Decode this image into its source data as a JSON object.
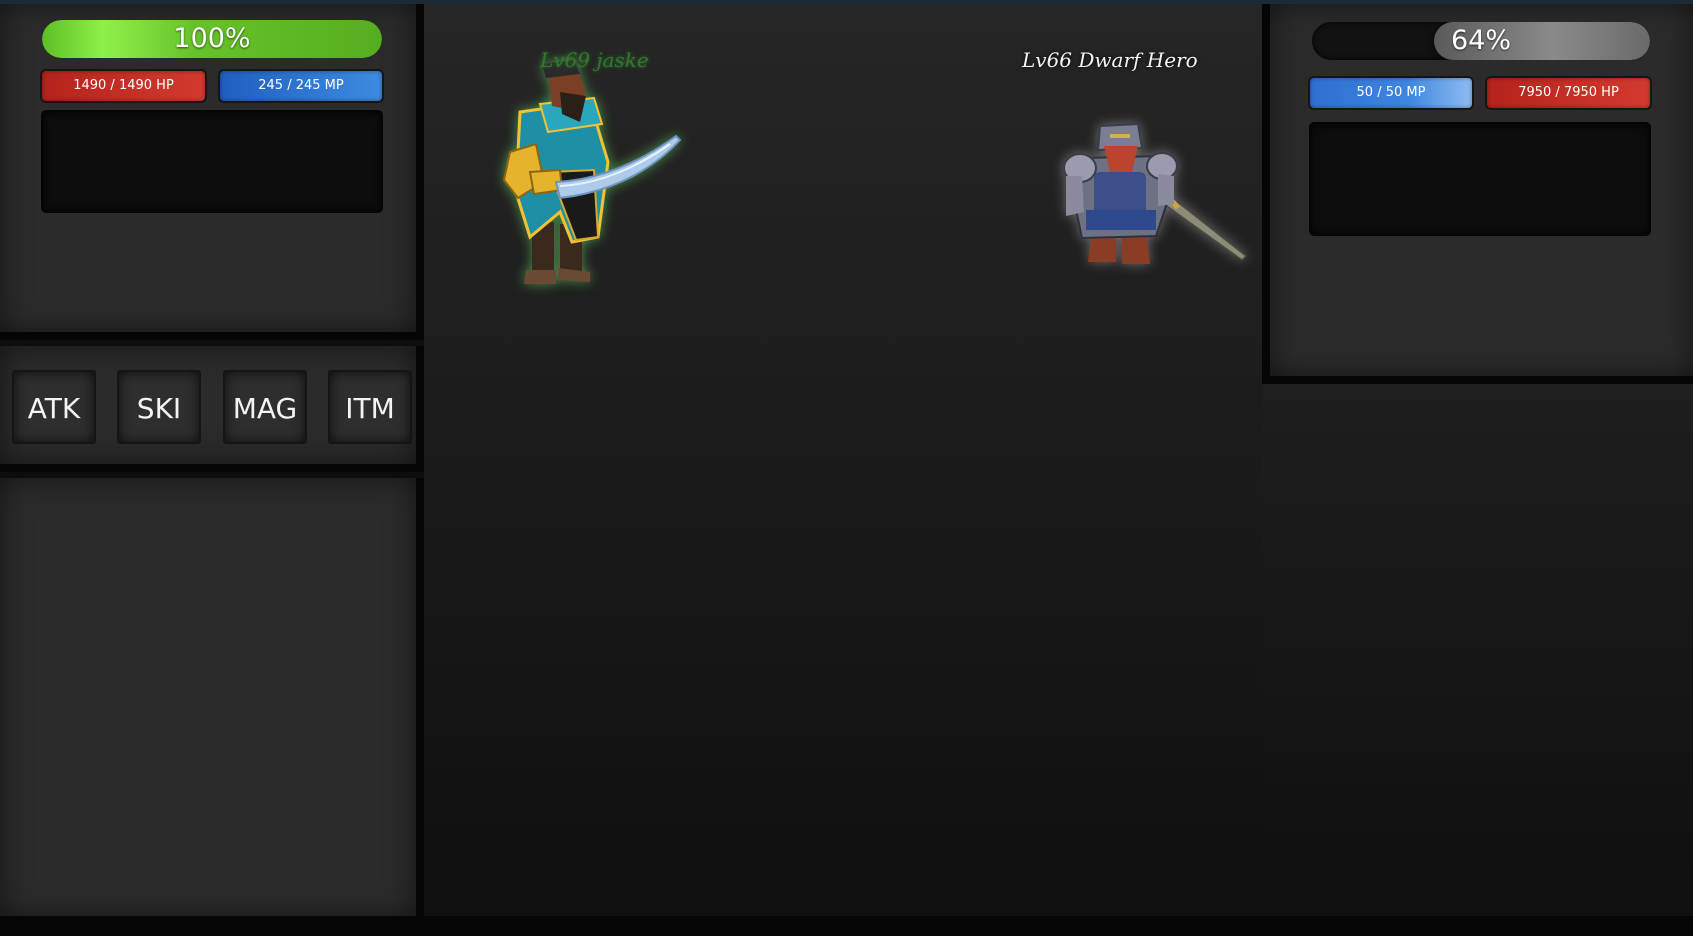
{
  "player": {
    "percent_label": "100%",
    "percent_value": 100,
    "hp_label": "1490 / 1490 HP",
    "mp_label": "245 / 245 MP",
    "name": "Lv69 jaske"
  },
  "enemy": {
    "percent_label": "64%",
    "percent_value": 64,
    "hp_label": "7950 / 7950 HP",
    "mp_label": "50 / 50 MP",
    "name": "Lv66 Dwarf Hero"
  },
  "actions": {
    "atk": "ATK",
    "ski": "SKI",
    "mag": "MAG",
    "itm": "ITM"
  },
  "colors": {
    "player_bar": "#66c22a",
    "enemy_bar": "#7a7a7a",
    "hp": "#c62b22",
    "mp": "#2e74d0",
    "player_name": "#2f7a2a"
  },
  "icons": {
    "player_sprite": "pirate-warrior-sprite",
    "enemy_sprite": "dwarf-knight-sprite"
  }
}
